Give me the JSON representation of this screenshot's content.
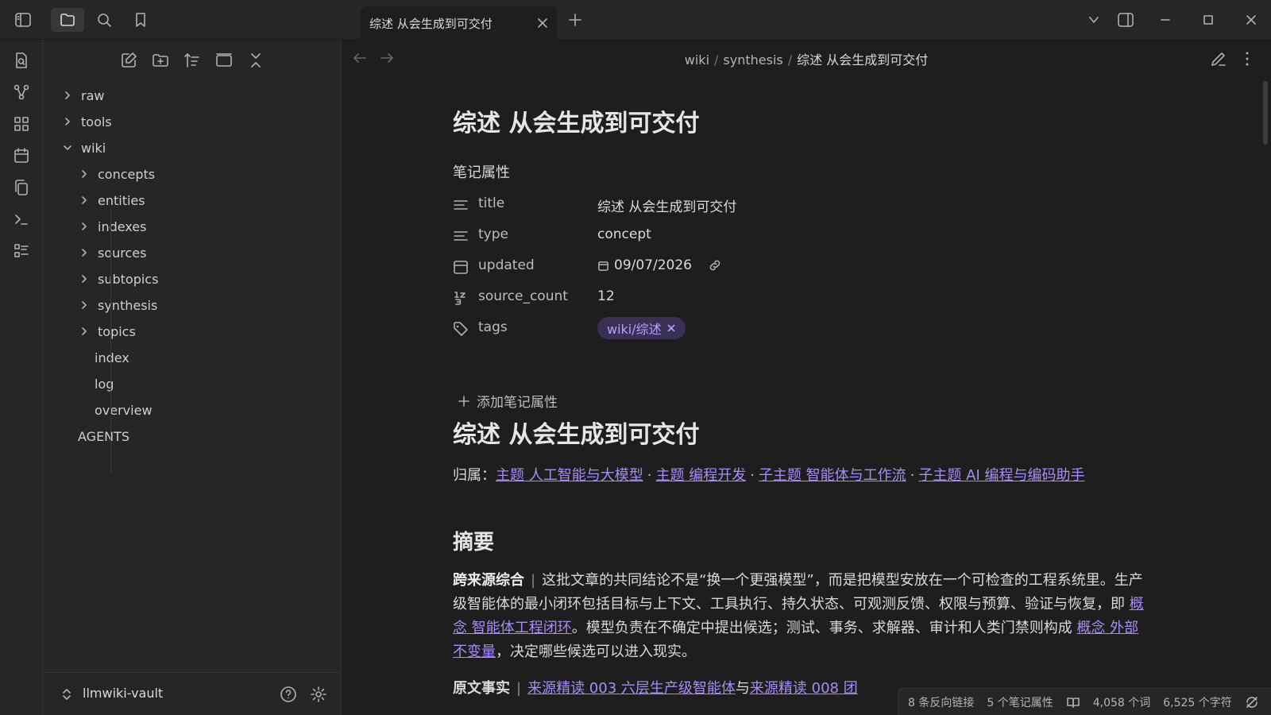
{
  "window": {
    "tab_title": "综述 从会生成到可交付"
  },
  "sidebar": {
    "tree": [
      {
        "label": "raw",
        "level": 0,
        "folder": true,
        "open": false
      },
      {
        "label": "tools",
        "level": 0,
        "folder": true,
        "open": false
      },
      {
        "label": "wiki",
        "level": 0,
        "folder": true,
        "open": true
      },
      {
        "label": "concepts",
        "level": 1,
        "folder": true,
        "open": false
      },
      {
        "label": "entities",
        "level": 1,
        "folder": true,
        "open": false
      },
      {
        "label": "indexes",
        "level": 1,
        "folder": true,
        "open": false
      },
      {
        "label": "sources",
        "level": 1,
        "folder": true,
        "open": false
      },
      {
        "label": "subtopics",
        "level": 1,
        "folder": true,
        "open": false
      },
      {
        "label": "synthesis",
        "level": 1,
        "folder": true,
        "open": false
      },
      {
        "label": "topics",
        "level": 1,
        "folder": true,
        "open": false
      },
      {
        "label": "index",
        "level": 1,
        "folder": false
      },
      {
        "label": "log",
        "level": 1,
        "folder": false
      },
      {
        "label": "overview",
        "level": 1,
        "folder": false
      },
      {
        "label": "AGENTS",
        "level": 0,
        "folder": false
      }
    ],
    "vault_name": "llmwiki-vault"
  },
  "breadcrumb": {
    "parts": [
      "wiki",
      "synthesis"
    ],
    "current": "综述 从会生成到可交付"
  },
  "note": {
    "title": "综述 从会生成到可交付",
    "props_heading": "笔记属性",
    "properties": [
      {
        "key": "title",
        "value": "综述 从会生成到可交付",
        "icon": "text-icon"
      },
      {
        "key": "type",
        "value": "concept",
        "icon": "text-icon"
      },
      {
        "key": "updated",
        "value": "09/07/2026",
        "icon": "calendar-icon"
      },
      {
        "key": "source_count",
        "value": "12",
        "icon": "number-icon"
      },
      {
        "key": "tags",
        "value": "wiki/综述",
        "icon": "tag-icon"
      }
    ],
    "add_property": "添加笔记属性",
    "body_title": "综述 从会生成到可交付",
    "belong_label": "归属：",
    "belong_links": [
      "主题 人工智能与大模型",
      "主题 编程开发",
      "子主题 智能体与工作流",
      "子主题 AI 编程与编码助手"
    ],
    "summary_heading": "摘要",
    "para1": {
      "bold": "跨来源综合",
      "text_a": "这批文章的共同结论不是“换一个更强模型”，而是把模型安放在一个可检查的工程系统里。生产级智能体的最小闭环包括目标与上下文、工具执行、持久状态、可观测反馈、权限与预算、验证与恢复，即 ",
      "link_a": "概念 智能体工程闭环",
      "text_b": "。模型负责在不确定中提出候选；测试、事务、求解器、审计和人类门禁则构成 ",
      "link_b": "概念 外部不变量",
      "text_c": "，决定哪些候选可以进入现实。"
    },
    "para2": {
      "bold": "原文事实",
      "link_a": "来源精读 003 六层生产级智能体",
      "text_a": "与",
      "link_b": "来源精读 008 团"
    }
  },
  "status": {
    "backlinks": "8 条反向链接",
    "props": "5 个笔记属性",
    "words": "4,058 个词",
    "chars": "6,525 个字符"
  }
}
